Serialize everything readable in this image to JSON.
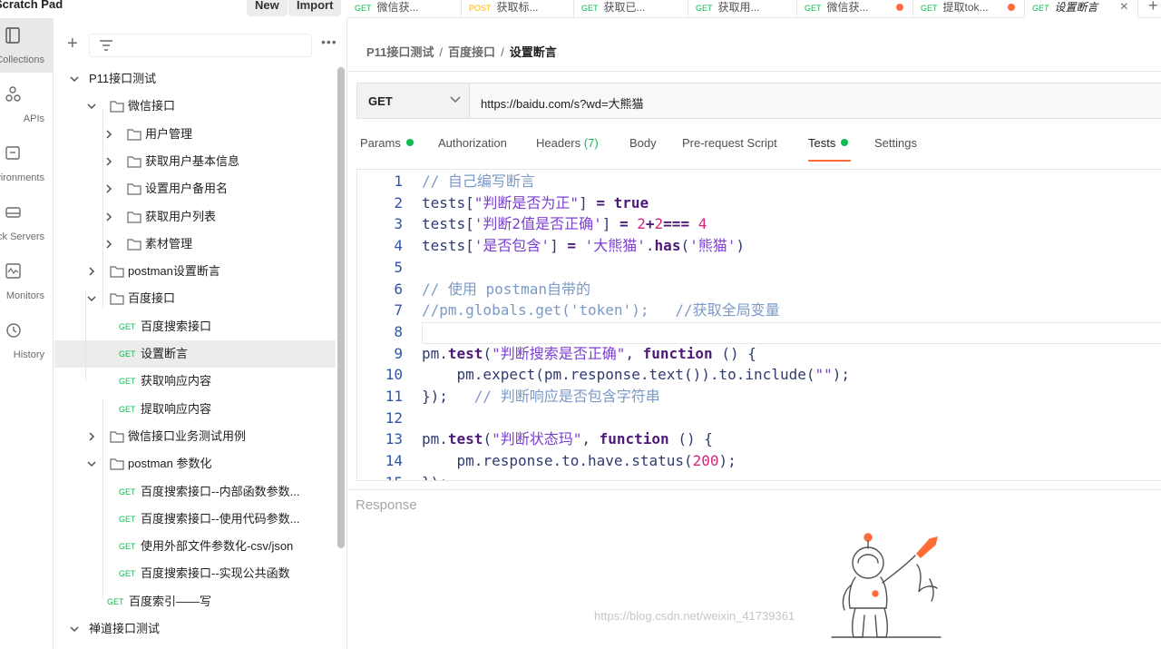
{
  "app": {
    "scratch_title": "Scratch Pad",
    "new_label": "New",
    "import_label": "Import"
  },
  "request_tabs": [
    {
      "method": "GET",
      "name": "微信获...",
      "dot": false
    },
    {
      "method": "POST",
      "name": "获取标...",
      "dot": false
    },
    {
      "method": "GET",
      "name": "获取已...",
      "dot": false
    },
    {
      "method": "GET",
      "name": "获取用...",
      "dot": false
    },
    {
      "method": "GET",
      "name": "微信获...",
      "dot": true
    },
    {
      "method": "GET",
      "name": "提取tok...",
      "dot": true
    },
    {
      "method": "GET",
      "name": "设置断言",
      "dot": false,
      "active": true
    }
  ],
  "rail": [
    {
      "label": "Collections",
      "icon": "collections-icon"
    },
    {
      "label": "APIs",
      "icon": "apis-icon"
    },
    {
      "label": "Environments",
      "icon": "environments-icon"
    },
    {
      "label": "Mock Servers",
      "icon": "mock-servers-icon"
    },
    {
      "label": "Monitors",
      "icon": "monitors-icon"
    },
    {
      "label": "History",
      "icon": "history-icon"
    }
  ],
  "tree": [
    {
      "type": "collection",
      "label": "P11接口测试",
      "open": true,
      "depth": 0
    },
    {
      "type": "folder",
      "label": "微信接口",
      "open": true,
      "depth": 1
    },
    {
      "type": "folder",
      "label": "用户管理",
      "open": false,
      "depth": 2
    },
    {
      "type": "folder",
      "label": "获取用户基本信息",
      "open": false,
      "depth": 2
    },
    {
      "type": "folder",
      "label": "设置用户备用名",
      "open": false,
      "depth": 2
    },
    {
      "type": "folder",
      "label": "获取用户列表",
      "open": false,
      "depth": 2
    },
    {
      "type": "folder",
      "label": "素材管理",
      "open": false,
      "depth": 2
    },
    {
      "type": "folder",
      "label": "postman设置断言",
      "open": false,
      "depth": 1
    },
    {
      "type": "folder",
      "label": "百度接口",
      "open": true,
      "depth": 1
    },
    {
      "type": "request",
      "method": "GET",
      "label": "百度搜索接口",
      "depth": 2
    },
    {
      "type": "request",
      "method": "GET",
      "label": "设置断言",
      "depth": 2,
      "selected": true
    },
    {
      "type": "request",
      "method": "GET",
      "label": "获取响应内容",
      "depth": 2
    },
    {
      "type": "request",
      "method": "GET",
      "label": "提取响应内容",
      "depth": 2
    },
    {
      "type": "folder",
      "label": "微信接口业务测试用例",
      "open": false,
      "depth": 1
    },
    {
      "type": "folder",
      "label": "postman 参数化",
      "open": true,
      "depth": 1
    },
    {
      "type": "request",
      "method": "GET",
      "label": "百度搜索接口--内部函数参数...",
      "depth": 2
    },
    {
      "type": "request",
      "method": "GET",
      "label": "百度搜索接口--使用代码参数...",
      "depth": 2
    },
    {
      "type": "request",
      "method": "GET",
      "label": "使用外部文件参数化-csv/json",
      "depth": 2
    },
    {
      "type": "request",
      "method": "GET",
      "label": "百度搜索接口--实现公共函数",
      "depth": 2
    },
    {
      "type": "request",
      "method": "GET",
      "label": "百度索引——写",
      "depth": 1
    },
    {
      "type": "collection",
      "label": "禅道接口测试",
      "open": true,
      "depth": 0
    }
  ],
  "breadcrumb": {
    "collection": "P11接口测试",
    "folder": "百度接口",
    "request": "设置断言"
  },
  "request": {
    "method": "GET",
    "url": "https://baidu.com/s?wd=大熊猫"
  },
  "req_tabs": {
    "params": "Params",
    "authorization": "Authorization",
    "headers": "Headers",
    "headers_count": "(7)",
    "body": "Body",
    "prerequest": "Pre-request Script",
    "tests": "Tests",
    "settings": "Settings"
  },
  "code": [
    {
      "n": "1",
      "html": "<span class=\"c-com\">// 自己编写断言</span>"
    },
    {
      "n": "2",
      "html": "tests[<span class=\"c-str\">\"判断是否为正\"</span>] <span class=\"c-kw\">=</span> <span class=\"c-kw\">true</span>"
    },
    {
      "n": "3",
      "html": "tests[<span class=\"c-str\">'判断2值是否正确'</span>] <span class=\"c-kw\">=</span> <span class=\"c-num\">2</span><span class=\"c-kw\">+</span><span class=\"c-num\">2</span><span class=\"c-kw\">===</span> <span class=\"c-num\">4</span>"
    },
    {
      "n": "4",
      "html": "tests[<span class=\"c-str\">'是否包含'</span>] <span class=\"c-kw\">=</span> <span class=\"c-str\">'大熊猫'</span>.<span class=\"c-kw\">has</span>(<span class=\"c-str\">'熊猫'</span>)"
    },
    {
      "n": "5",
      "html": ""
    },
    {
      "n": "6",
      "html": "<span class=\"c-com\">// 使用 postman自带的</span>"
    },
    {
      "n": "7",
      "html": "<span class=\"c-com\">//pm.globals.get('token');   //获取全局变量</span>"
    },
    {
      "n": "8",
      "html": ""
    },
    {
      "n": "9",
      "html": "pm.<span class=\"c-kw\">test</span>(<span class=\"c-str\">\"判断搜索是否正确\"</span>, <span class=\"c-kw\">function</span> () {"
    },
    {
      "n": "10",
      "html": "    pm.expect(pm.response.text()).to.include(<span class=\"c-str\">\"\"</span>);"
    },
    {
      "n": "11",
      "html": "});   <span class=\"c-com\">// 判断响应是否包含字符串</span>"
    },
    {
      "n": "12",
      "html": ""
    },
    {
      "n": "13",
      "html": "pm.<span class=\"c-kw\">test</span>(<span class=\"c-str\">\"判断状态玛\"</span>, <span class=\"c-kw\">function</span> () {"
    },
    {
      "n": "14",
      "html": "    pm.response.to.have.status(<span class=\"c-num\">200</span>);"
    },
    {
      "n": "15",
      "html": "});"
    }
  ],
  "response": {
    "label": "Response"
  },
  "watermark": "https://blog.csdn.net/weixin_41739361"
}
